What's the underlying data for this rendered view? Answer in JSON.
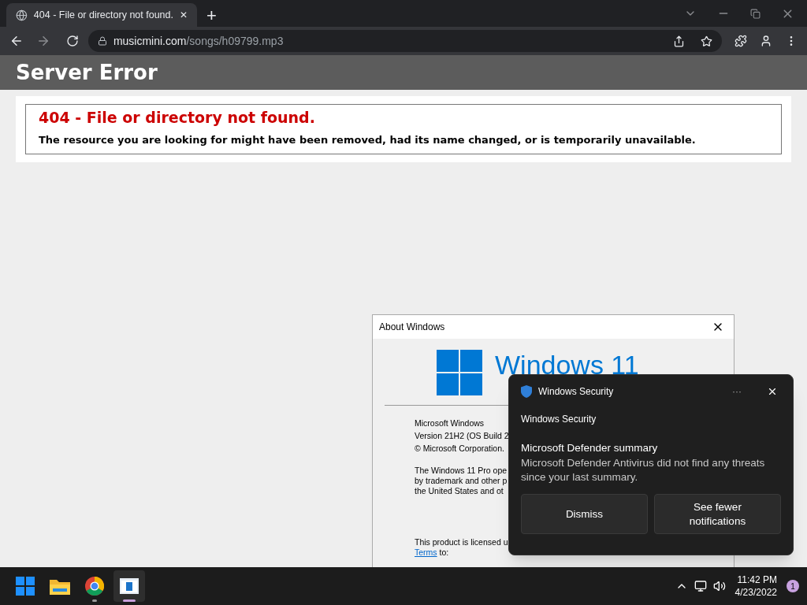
{
  "browser": {
    "tab": {
      "title": "404 - File or directory not found.",
      "close": "✕",
      "selected": true
    },
    "new_tab": "+",
    "url_host": "musicmini.com",
    "url_path": "/songs/h09799.mp3"
  },
  "page": {
    "header": "Server Error",
    "error_title": "404 - File or directory not found.",
    "error_message": "The resource you are looking for might have been removed, had its name changed, or is temporarily unavailable."
  },
  "about_dialog": {
    "title": "About Windows",
    "logo_text": "Windows 11",
    "lines": [
      "Microsoft Windows",
      "Version 21H2 (OS Build 2",
      "© Microsoft Corporation."
    ],
    "paragraph": [
      "The Windows 11 Pro ope",
      "by trademark and other p",
      "the United States and ot"
    ],
    "license_line": "This product is licensed u",
    "terms_link": "Terms",
    "terms_after": " to:"
  },
  "toast": {
    "app": "Windows Security",
    "more": "···",
    "source": "Windows Security",
    "heading": "Microsoft Defender summary",
    "body": "Microsoft Defender Antivirus did not find any threats since your last summary.",
    "buttons": [
      "Dismiss",
      "See fewer notifications"
    ]
  },
  "taskbar": {
    "apps": [
      {
        "kind": "start",
        "active": false
      },
      {
        "kind": "explorer",
        "active": false
      },
      {
        "kind": "chrome",
        "active": false,
        "running": true
      },
      {
        "kind": "about",
        "active": true,
        "running": true
      }
    ],
    "time": "11:42 PM",
    "date": "4/23/2022",
    "notifications": "1"
  }
}
